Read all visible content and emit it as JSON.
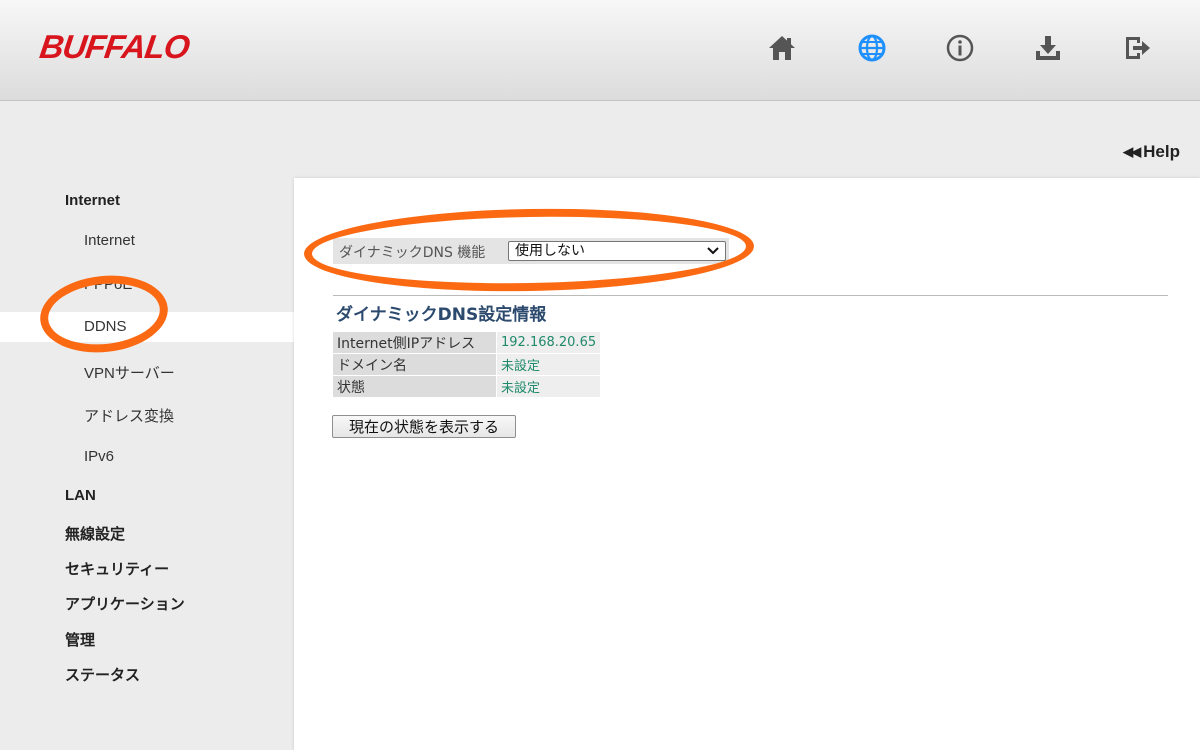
{
  "header": {
    "logo": "BUFFALO",
    "icons": [
      "home-icon",
      "globe-icon",
      "info-icon",
      "download-icon",
      "logout-icon"
    ],
    "active_icon_color": "#1e90ff"
  },
  "help": {
    "label": "Help",
    "arrows": "◀◀"
  },
  "sidebar": {
    "groups": [
      {
        "label": "Internet",
        "items": [
          "Internet",
          "PPPoE",
          "DDNS",
          "VPNサーバー",
          "アドレス変換",
          "IPv6"
        ]
      },
      {
        "label": "LAN"
      },
      {
        "label": "無線設定"
      },
      {
        "label": "セキュリティー"
      },
      {
        "label": "アプリケーション"
      },
      {
        "label": "管理"
      },
      {
        "label": "ステータス"
      }
    ],
    "active_item": "DDNS"
  },
  "ddns": {
    "label": "ダイナミックDNS 機能",
    "selected": "使用しない"
  },
  "info": {
    "title": "ダイナミックDNS設定情報",
    "rows": [
      {
        "key": "Internet側IPアドレス",
        "value": "192.168.20.65"
      },
      {
        "key": "ドメイン名",
        "value": "未設定"
      },
      {
        "key": "状態",
        "value": "未設定"
      }
    ],
    "button": "現在の状態を表示する"
  },
  "annotation_color": "#fb6a13"
}
